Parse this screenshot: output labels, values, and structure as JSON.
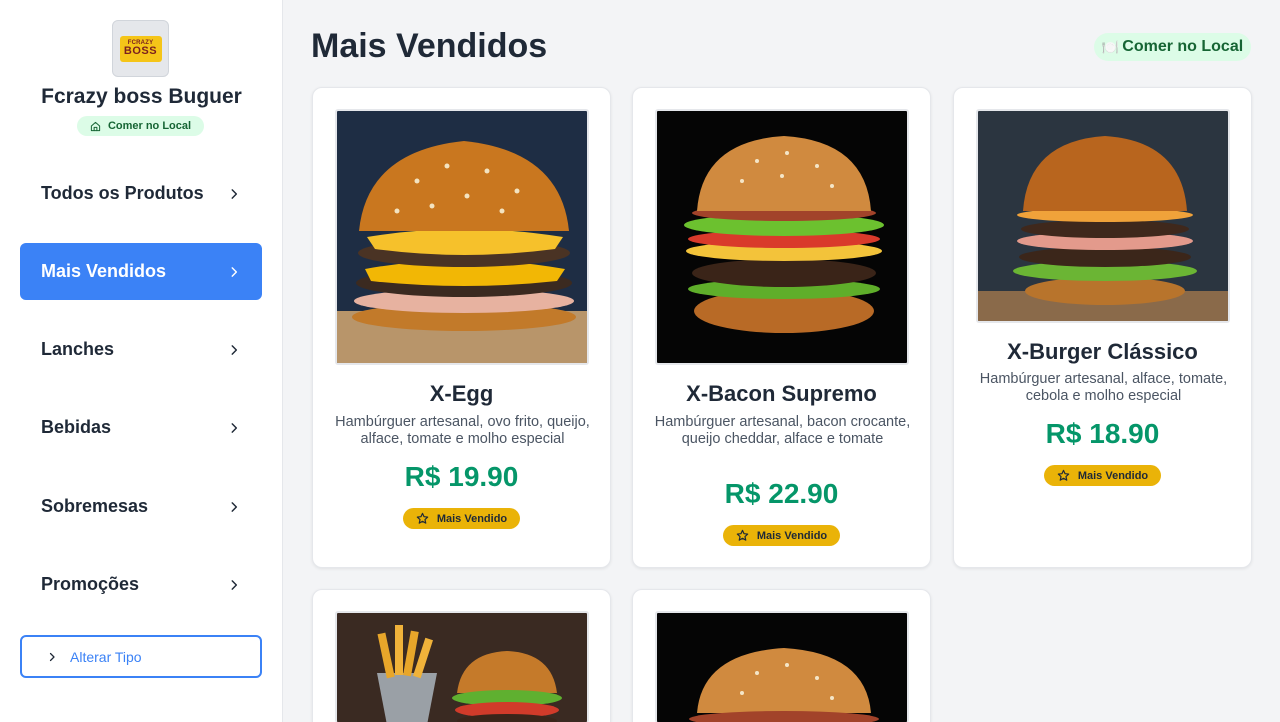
{
  "store": {
    "logo_top": "FCRAZY",
    "logo_bottom": "BOSS",
    "name": "Fcrazy boss Buguer",
    "mode_badge": "Comer no Local"
  },
  "nav": [
    {
      "label": "Todos os Produtos",
      "active": false
    },
    {
      "label": "Mais Vendidos",
      "active": true
    },
    {
      "label": "Lanches",
      "active": false
    },
    {
      "label": "Bebidas",
      "active": false
    },
    {
      "label": "Sobremesas",
      "active": false
    },
    {
      "label": "Promoções",
      "active": false
    }
  ],
  "alter_button": "Alterar Tipo",
  "header": {
    "title": "Mais Vendidos",
    "mode_pill_icon": "🍽️",
    "mode_pill_text": "Comer no Local"
  },
  "products": [
    {
      "name": "X-Egg",
      "description": "Hambúrguer artesanal, ovo frito, queijo, alface, tomate e molho especial",
      "price": "R$ 19.90",
      "badge": "Mais Vendido"
    },
    {
      "name": "X-Bacon Supremo",
      "description": "Hambúrguer artesanal, bacon crocante, queijo cheddar, alface e tomate",
      "price": "R$ 22.90",
      "badge": "Mais Vendido"
    },
    {
      "name": "X-Burger Clássico",
      "description": "Hambúrguer artesanal, alface, tomate, cebola e molho especial",
      "price": "R$ 18.90",
      "badge": "Mais Vendido"
    }
  ],
  "colors": {
    "accent": "#3b82f6",
    "price": "#059669",
    "badge": "#eab308",
    "mode_bg": "#dcfce7"
  }
}
